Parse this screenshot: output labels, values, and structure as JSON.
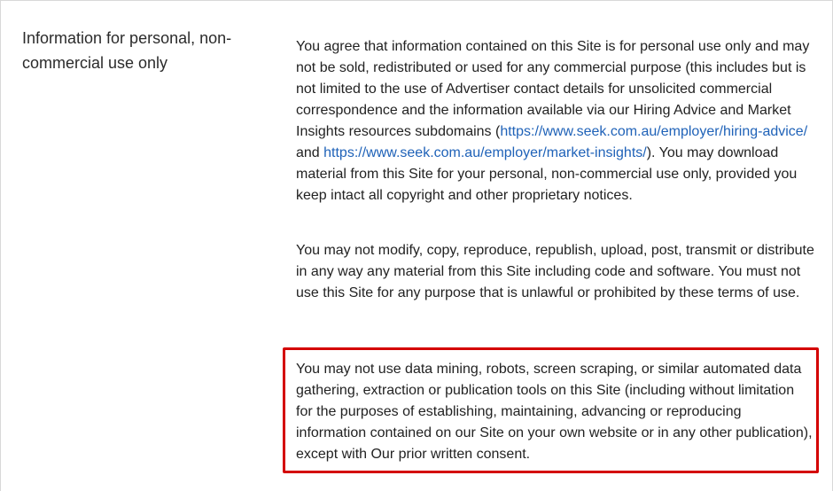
{
  "section": {
    "heading": "Information for personal, non-commercial use only"
  },
  "paragraphs": {
    "p1": {
      "text_before_link1": "You agree that information contained on this Site is for personal use only and may not be sold, redistributed or used for any commercial purpose (this includes but is not limited to the use of Advertiser contact details for unsolicited commercial correspondence and the information available via our Hiring Advice and Market Insights resources subdomains (",
      "link1": "https://www.seek.com.au/employer/hiring-advice/",
      "text_between_links": " and ",
      "link2": "https://www.seek.com.au/employer/market-insights/",
      "text_after_link2": "). You may download material from this Site for your personal, non-commercial use only, provided you keep intact all copyright and other proprietary notices."
    },
    "p2": "You may not modify, copy, reproduce, republish, upload, post, transmit or distribute in any way any material from this Site including code and software. You must not use this Site for any purpose that is unlawful or prohibited by these terms of use.",
    "p3": "You may not use data mining, robots, screen scraping, or similar automated data gathering, extraction or publication tools on this Site (including without limitation for the purposes of establishing, maintaining, advancing or reproducing information contained on our Site on your own website or in any other publication), except with Our prior written consent."
  },
  "colors": {
    "link": "#1f62b8",
    "highlight_border": "#d40000",
    "text": "#222222"
  }
}
